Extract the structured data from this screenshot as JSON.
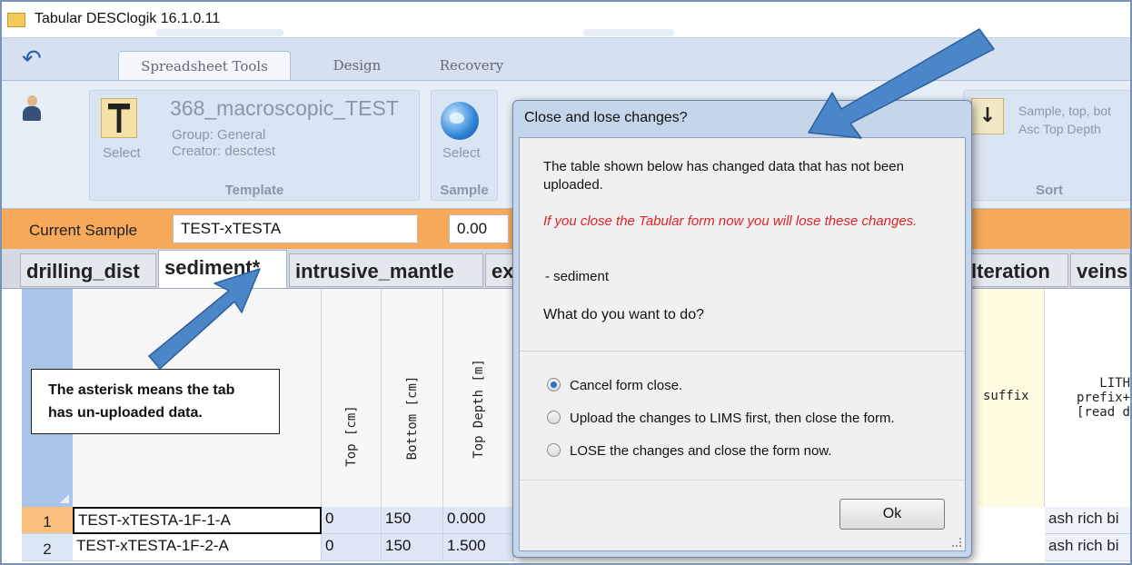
{
  "window": {
    "title": "Tabular DESClogik 16.1.0.11"
  },
  "ribbon": {
    "tabs": [
      {
        "label": "Spreadsheet Tools"
      },
      {
        "label": "Design"
      },
      {
        "label": "Recovery"
      }
    ],
    "template": {
      "name": "368_macroscopic_TEST",
      "group": "Group: General",
      "creator": "Creator: desctest",
      "select_label": "Select",
      "group_label": "Template"
    },
    "sample": {
      "select_label": "Select",
      "group_label": "Sample"
    },
    "sort": {
      "line1": "Sample, top, bot",
      "line2": "Asc Top Depth",
      "group_label": "Sort"
    }
  },
  "current_sample": {
    "label": "Current Sample",
    "value": "TEST-xTESTA",
    "depth": "0.00"
  },
  "sheet_tabs": [
    {
      "label": "drilling_dist"
    },
    {
      "label": "sediment*"
    },
    {
      "label": "intrusive_mantle"
    },
    {
      "label": "ex"
    },
    {
      "label": "lteration"
    },
    {
      "label": "veins"
    }
  ],
  "columns": {
    "top": "Top [cm]",
    "bottom": "Bottom [cm]",
    "top_depth": "Top Depth [m]",
    "suffix": "suffix",
    "lith_line1": "LITH",
    "lith_line2": "prefix+",
    "lith_line3": "[read d"
  },
  "rows": [
    {
      "num": "1",
      "id": "TEST-xTESTA-1F-1-A",
      "top": "0",
      "bottom": "150",
      "depth": "0.000",
      "lith": "ash rich bi"
    },
    {
      "num": "2",
      "id": "TEST-xTESTA-1F-2-A",
      "top": "0",
      "bottom": "150",
      "depth": "1.500",
      "lith": "ash rich bi"
    }
  ],
  "callout": {
    "text": "The asterisk means the tab has un-uploaded data."
  },
  "dialog": {
    "title": "Close and lose changes?",
    "message": "The table shown below has changed data that has not been uploaded.",
    "warning": "If you close the Tabular form now you will lose these changes.",
    "changed_item": "- sediment",
    "question": "What do you want to do?",
    "options": [
      {
        "label": "Cancel form close.",
        "selected": true
      },
      {
        "label": "Upload the changes to LIMS first, then close the form.",
        "selected": false
      },
      {
        "label": "LOSE the changes and close the form now.",
        "selected": false
      }
    ],
    "ok_label": "Ok"
  },
  "colors": {
    "accent_orange": "#f6a95a",
    "selected_row": "#f8c07c",
    "warning_red": "#e0232a",
    "arrow_blue": "#4a86c8"
  }
}
